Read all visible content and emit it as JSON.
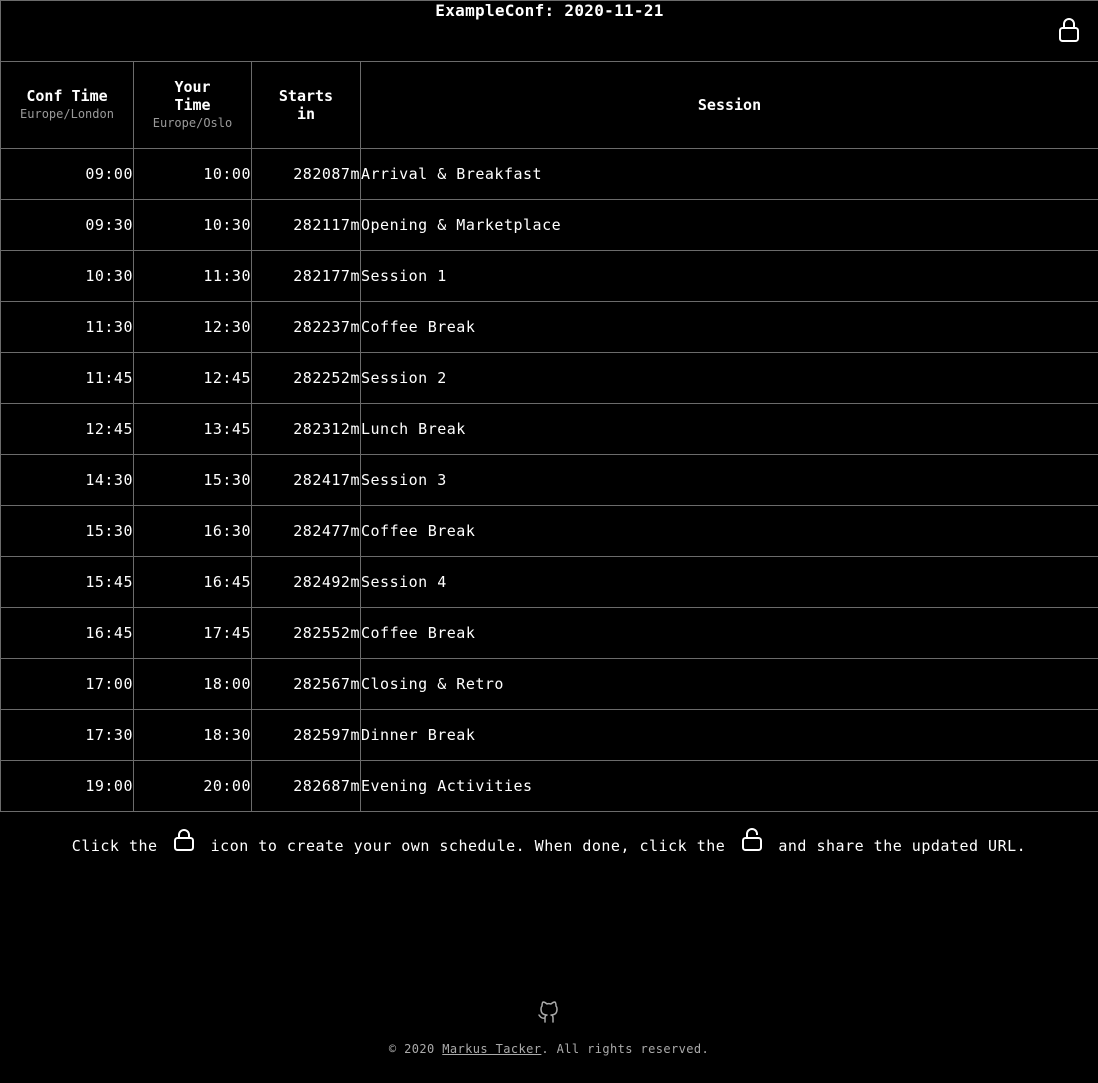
{
  "header": {
    "title": "ExampleConf: 2020-11-21"
  },
  "columns": {
    "conf_time": "Conf Time",
    "conf_tz": "Europe/London",
    "your_time_1": "Your",
    "your_time_2": "Time",
    "your_tz": "Europe/Oslo",
    "starts_1": "Starts",
    "starts_2": "in",
    "session": "Session"
  },
  "rows": [
    {
      "conf": "09:00",
      "your": "10:00",
      "starts": "282087m",
      "session": "Arrival & Breakfast"
    },
    {
      "conf": "09:30",
      "your": "10:30",
      "starts": "282117m",
      "session": "Opening & Marketplace"
    },
    {
      "conf": "10:30",
      "your": "11:30",
      "starts": "282177m",
      "session": "Session 1"
    },
    {
      "conf": "11:30",
      "your": "12:30",
      "starts": "282237m",
      "session": "Coffee Break"
    },
    {
      "conf": "11:45",
      "your": "12:45",
      "starts": "282252m",
      "session": "Session 2"
    },
    {
      "conf": "12:45",
      "your": "13:45",
      "starts": "282312m",
      "session": "Lunch Break"
    },
    {
      "conf": "14:30",
      "your": "15:30",
      "starts": "282417m",
      "session": "Session 3"
    },
    {
      "conf": "15:30",
      "your": "16:30",
      "starts": "282477m",
      "session": "Coffee Break"
    },
    {
      "conf": "15:45",
      "your": "16:45",
      "starts": "282492m",
      "session": "Session 4"
    },
    {
      "conf": "16:45",
      "your": "17:45",
      "starts": "282552m",
      "session": "Coffee Break"
    },
    {
      "conf": "17:00",
      "your": "18:00",
      "starts": "282567m",
      "session": "Closing & Retro"
    },
    {
      "conf": "17:30",
      "your": "18:30",
      "starts": "282597m",
      "session": "Dinner Break"
    },
    {
      "conf": "19:00",
      "your": "20:00",
      "starts": "282687m",
      "session": "Evening Activities"
    }
  ],
  "hint": {
    "part1": "Click the",
    "part2": "icon to create your own schedule. When done, click the",
    "part3": "and share the updated URL."
  },
  "footer": {
    "prefix": "© 2020 ",
    "author": "Markus Tacker",
    "suffix": ". All rights reserved."
  },
  "icons": {
    "lock": "lock-icon",
    "unlock": "unlock-icon",
    "github": "github-icon"
  }
}
